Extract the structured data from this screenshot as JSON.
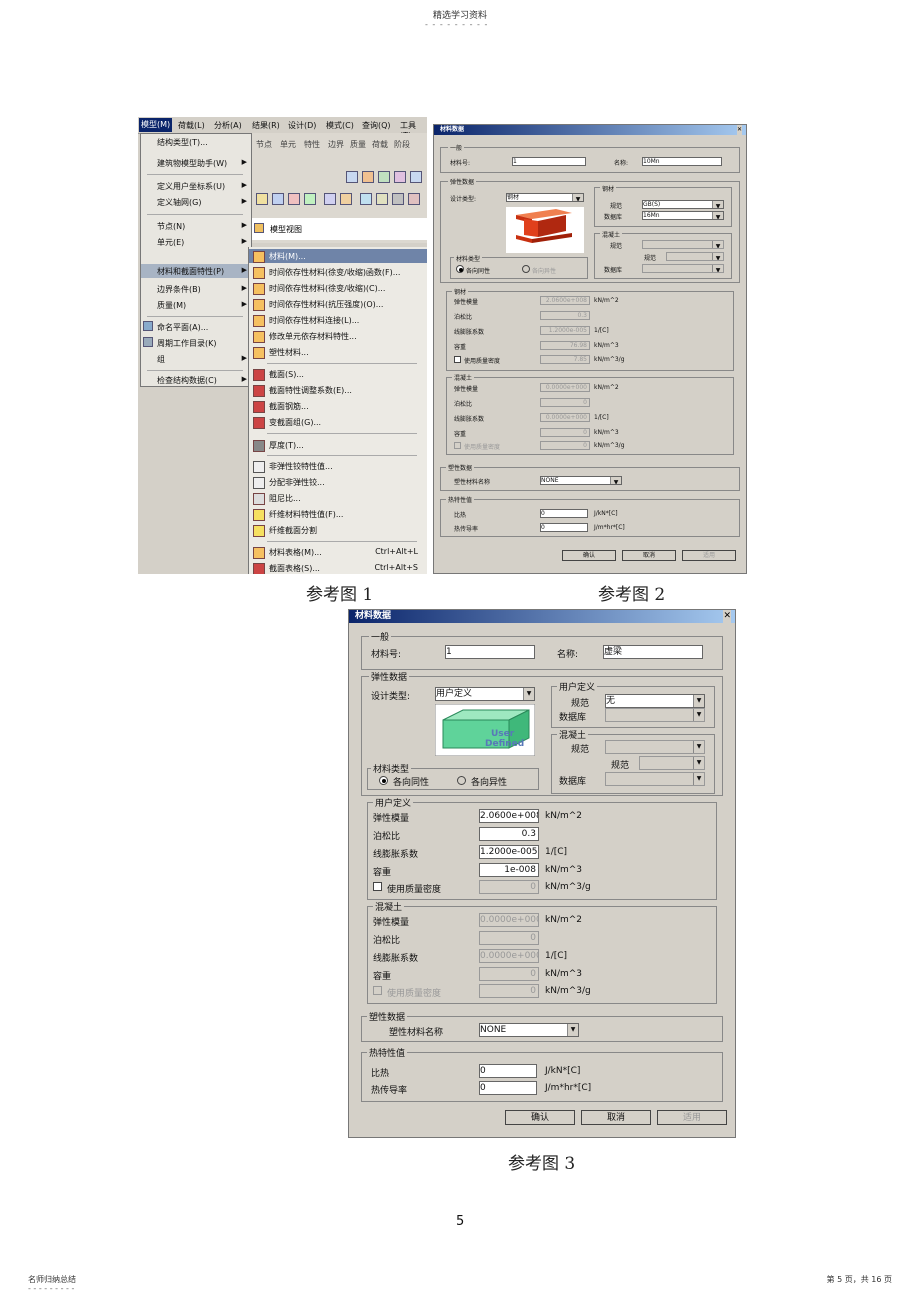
{
  "header": {
    "title": "精选学习资料",
    "dashes": "- - - - - - - - -"
  },
  "fig1": {
    "menubar": [
      "模型(M)",
      "荷载(L)",
      "分析(A)",
      "结果(R)",
      "设计(D)",
      "模式(C)",
      "查询(Q)",
      "工具(T)"
    ],
    "toolbar_tabs": [
      "节点",
      "单元",
      "特性",
      "边界",
      "质量",
      "荷载",
      "阶段"
    ],
    "window_tab": "模型视图",
    "model_menu": [
      {
        "label": "结构类型(T)...",
        "arrow": false
      },
      {
        "label": "建筑物模型助手(W)",
        "arrow": true
      },
      {
        "label": "定义用户坐标系(U)",
        "arrow": true
      },
      {
        "label": "定义轴网(G)",
        "arrow": true
      },
      {
        "label": "节点(N)",
        "arrow": true
      },
      {
        "label": "单元(E)",
        "arrow": true
      },
      {
        "label": "材料和截面特性(P)",
        "arrow": true,
        "highlight": true
      },
      {
        "label": "边界条件(B)",
        "arrow": true
      },
      {
        "label": "质量(M)",
        "arrow": true
      },
      {
        "label": "命名平面(A)...",
        "arrow": false
      },
      {
        "label": "周期工作目录(K)",
        "arrow": false
      },
      {
        "label": "组",
        "arrow": true
      },
      {
        "label": "检查结构数据(C)",
        "arrow": true
      }
    ],
    "submenu": [
      {
        "label": "材料(M)...",
        "highlight": true
      },
      {
        "label": "时间依存性材料(徐变/收缩)函数(F)..."
      },
      {
        "label": "时间依存性材料(徐变/收缩)(C)..."
      },
      {
        "label": "时间依存性材料(抗压强度)(O)..."
      },
      {
        "label": "时间依存性材料连接(L)..."
      },
      {
        "label": "修改单元依存材料特性..."
      },
      {
        "label": "塑性材料..."
      },
      {
        "label": "截面(S)..."
      },
      {
        "label": "截面特性调整系数(E)..."
      },
      {
        "label": "截面钢筋..."
      },
      {
        "label": "变截面组(G)..."
      },
      {
        "label": "厚度(T)..."
      },
      {
        "label": "非弹性铰特性值..."
      },
      {
        "label": "分配非弹性铰..."
      },
      {
        "label": "阻尼比..."
      },
      {
        "label": "纤维材料特性值(F)..."
      },
      {
        "label": "纤维截面分割"
      },
      {
        "label": "材料表格(M)...",
        "shortcut": "Ctrl+Alt+L"
      },
      {
        "label": "截面表格(S)...",
        "shortcut": "Ctrl+Alt+S"
      }
    ]
  },
  "dialog": {
    "title": "材料数据",
    "general_group": "一般",
    "material_no_label": "材料号:",
    "material_no": "1",
    "name_label": "名称:",
    "elastic_group": "弹性数据",
    "design_type_label": "设计类型:",
    "material_type_group": "材料类型",
    "isotropic": "各向同性",
    "anisotropic": "各向异性",
    "standard_label": "规范",
    "database_label": "数据库",
    "concrete_group": "混凝土",
    "modulus_label": "弹性模量",
    "poisson_label": "泊松比",
    "thermal_label": "线膨胀系数",
    "weight_label": "容重",
    "use_mass_label": "使用质量密度",
    "plastic_group": "塑性数据",
    "plastic_name_label": "塑性材料名称",
    "plastic_name": "NONE",
    "thermal_group": "热特性值",
    "specific_heat_label": "比热",
    "conductivity_label": "热传导率",
    "specific_heat": "0",
    "conductivity": "0",
    "ok": "确认",
    "cancel": "取消",
    "apply": "适用",
    "units": {
      "modulus": "kN/m^2",
      "thermal": "1/[C]",
      "weight": "kN/m^3",
      "mass": "kN/m^3/g",
      "heat": "J/kN*[C]",
      "cond": "J/m*hr*[C]"
    }
  },
  "dialog2": {
    "name": "10Mn",
    "design_type": "钢材",
    "steel_group": "钢材",
    "standard": "GB(S)",
    "database": "16Mn",
    "steel_section": "钢材",
    "modulus": "2.0600e+008",
    "poisson": "0.3",
    "thermal": "1.2000e-005",
    "weight": "76.98",
    "mass": "7.85",
    "c_modulus": "0.0000e+000",
    "c_poisson": "0",
    "c_thermal": "0.0000e+000",
    "c_weight": "0",
    "c_mass": "0"
  },
  "dialog3": {
    "name": "虚梁",
    "design_type": "用户定义",
    "ud_group": "用户定义",
    "standard": "无",
    "preview_text": [
      "User",
      "Defined"
    ],
    "ud_section": "用户定义",
    "modulus": "2.0600e+008",
    "poisson": "0.3",
    "thermal": "1.2000e-005",
    "weight": "1e-008",
    "mass": "0",
    "c_modulus": "0.0000e+000",
    "c_poisson": "0",
    "c_thermal": "0.0000e+000",
    "c_weight": "0",
    "c_mass": "0"
  },
  "captions": {
    "fig1": "参考图 1",
    "fig2": "参考图 2",
    "fig3": "参考图 3"
  },
  "page_number": "5",
  "footer": {
    "left": "名师归纳总结",
    "left_dashes": "- - - - - - - - -",
    "right": "第 5 页，共 16 页"
  },
  "colors": {
    "title_bar": "#0a246a",
    "menu_highlight": "#6f84a8",
    "steel_beam": "#e0401c",
    "ud_box": "#5fd39a"
  }
}
